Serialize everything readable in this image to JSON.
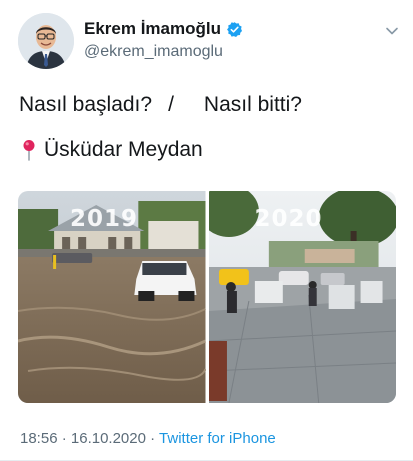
{
  "author": {
    "display_name": "Ekrem İmamoğlu",
    "handle": "@ekrem_imamoglu",
    "verified": true
  },
  "tweet": {
    "line1_part1": "Nasıl başladı?",
    "separator": "/",
    "line1_part2": "Nasıl bitti?",
    "location_text": "Üsküdar Meydan"
  },
  "media": {
    "left_label": "2019",
    "right_label": "2020"
  },
  "footer": {
    "time": "18:56",
    "dot1": " · ",
    "date": "16.10.2020",
    "dot2": " · ",
    "source": "Twitter for iPhone"
  },
  "icons": {
    "verified": "verified-badge-icon",
    "menu": "chevron-down-icon",
    "location": "round-pushpin-icon"
  },
  "colors": {
    "verified_blue": "#1da1f2",
    "link_blue": "#1b95e0",
    "secondary_text": "#5b6b78",
    "pin_red": "#e0245e"
  }
}
